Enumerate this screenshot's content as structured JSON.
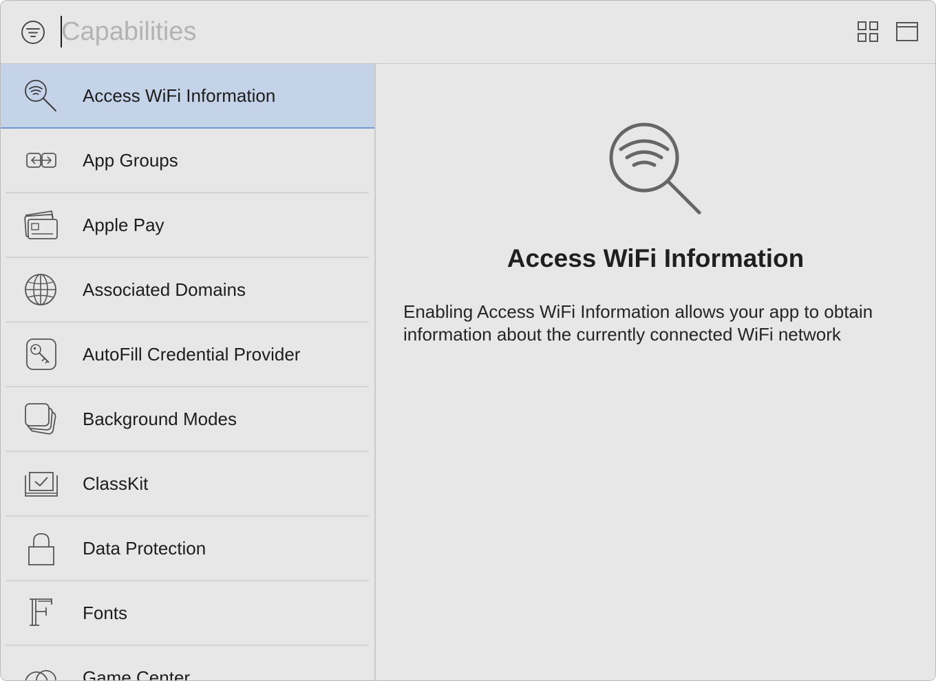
{
  "toolbar": {
    "search_placeholder": "Capabilities",
    "search_value": "",
    "filter_icon": "filter-icon",
    "grid_view_icon": "grid-view-icon",
    "panel_view_icon": "panel-view-icon"
  },
  "capabilities": [
    {
      "label": "Access WiFi Information",
      "icon": "wifi-search-icon",
      "selected": true
    },
    {
      "label": "App Groups",
      "icon": "app-groups-icon",
      "selected": false
    },
    {
      "label": "Apple Pay",
      "icon": "apple-pay-icon",
      "selected": false
    },
    {
      "label": "Associated Domains",
      "icon": "globe-icon",
      "selected": false
    },
    {
      "label": "AutoFill Credential Provider",
      "icon": "key-icon",
      "selected": false
    },
    {
      "label": "Background Modes",
      "icon": "background-modes-icon",
      "selected": false
    },
    {
      "label": "ClassKit",
      "icon": "classkit-icon",
      "selected": false
    },
    {
      "label": "Data Protection",
      "icon": "lock-icon",
      "selected": false
    },
    {
      "label": "Fonts",
      "icon": "fonts-icon",
      "selected": false
    },
    {
      "label": "Game Center",
      "icon": "game-center-icon",
      "selected": false
    }
  ],
  "detail": {
    "icon": "wifi-search-icon",
    "title": "Access WiFi Information",
    "description": "Enabling Access WiFi Information allows your app to obtain information about the currently connected WiFi network"
  },
  "colors": {
    "background": "#e7e7e7",
    "selection": "#c4d3e8",
    "selection_border": "#6e97d2"
  }
}
